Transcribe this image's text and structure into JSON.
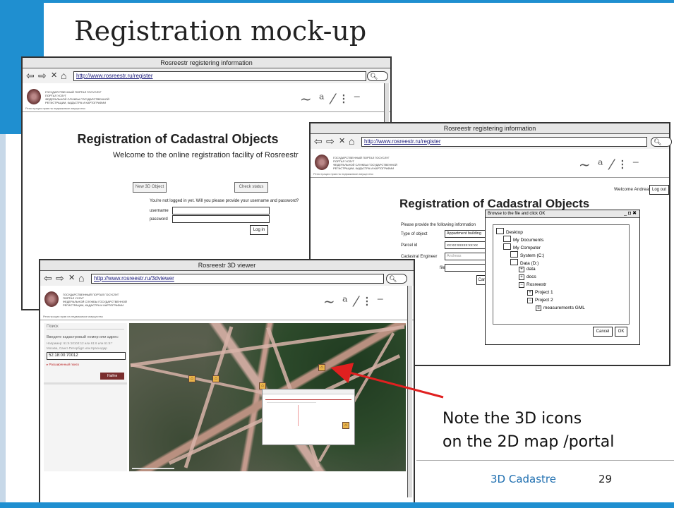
{
  "slide": {
    "title": "Registration mock-up",
    "note_line1": "Note the 3D icons",
    "note_line2": "on the 2D map /portal",
    "footer_label": "3D Cadastre",
    "page_number": "29",
    "accent_color": "#1f8fd0"
  },
  "win1": {
    "title": "Rosreestr registering information",
    "url": "http://www.rosreestr.ru/register",
    "heading": "Registration of Cadastral Objects",
    "welcome": "Welcome to the online registration facility of Rosreestr",
    "btn_new": "New 3D Object",
    "btn_status": "Check status",
    "login_prompt": "You're not logged in yet. Will you please provide your username and password?",
    "username_label": "username",
    "password_label": "password",
    "login_button": "Log in"
  },
  "win2": {
    "title": "Rosreestr registering information",
    "url": "http://www.rosreestr.ru/register",
    "welcome_user": "Welcome Andreas",
    "logout_button": "Log out",
    "heading": "Registration of Cadastral Objects",
    "instructions": "Please provide the following information",
    "type_label": "Type of object",
    "type_value": "Appartment building",
    "parcel_label": "Parcel id",
    "parcel_value": "XX:XX:XXXXX:XX:XX",
    "engineer_label": "Cadastral Engineer",
    "engineer_value": "Andreas",
    "file_label": "file",
    "cancel_partial": "Can"
  },
  "dialog": {
    "title": "Browse to the file and click OK",
    "controls": "_ ◘ ✖",
    "items": [
      "Desktop",
      "My Documents",
      "My Computer",
      "System (C:)",
      "Data (D:)",
      "data",
      "docs",
      "Rosreestr",
      "Project 1",
      "Project 2",
      "measurements GML"
    ],
    "cancel": "Cancel",
    "ok": "OK"
  },
  "win3": {
    "title": "Rosreestr 3D viewer",
    "url": "http://www.rosreestr.ru/3dviewer",
    "search_header": "Поиск",
    "search_hint": "Введите кадастровый номер или адрес:",
    "search_example": "Например: 61:6:10104:12 или 61:6 или 61:6:*",
    "search_cities": "Москва, Санкт-Петербург или Краснодар",
    "search_value": "52:18:00:70012",
    "advanced_search": "▸ Расширенный поиск",
    "find_button": "Найти"
  },
  "header": {
    "portal_line1": "ГОСУДАРСТВЕННЫЙ ПОРТАЛ ГОСУСЛУГ",
    "portal_line2": "ПОРТАЛ УСЛУГ",
    "portal_line3": "ФЕДЕРАЛЬНОЙ СЛУЖБЫ ГОСУДАРСТВЕННОЙ",
    "portal_line4": "РЕГИСТРАЦИИ, КАДАСТРА И КАРТОГРАФИИ",
    "breadcrumb": "Регистрация прав на недвижимое имущество",
    "signature": "~ᐟ⁄ᐟ ⁚ ⁻"
  }
}
